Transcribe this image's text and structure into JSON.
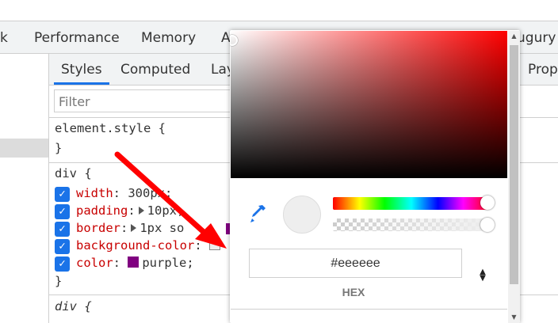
{
  "devtools": {
    "panel_tabs": [
      "k",
      "Performance",
      "Memory",
      "A",
      "ugury"
    ],
    "sub_tabs": [
      "Styles",
      "Computed",
      "Lay",
      "Prop"
    ],
    "filter_placeholder": "Filter"
  },
  "styles": {
    "element_style_selector": "element.style {",
    "close_brace": "}",
    "div_selector": "div {",
    "properties": [
      {
        "name": "width",
        "value": "300px;"
      },
      {
        "name": "padding",
        "value": "10px;"
      },
      {
        "name": "border",
        "value": "1px so"
      },
      {
        "name": "background-color",
        "value": ""
      },
      {
        "name": "color",
        "value": "purple;"
      }
    ],
    "next_selector": "div {"
  },
  "color_picker": {
    "current_color": "#eeeeee",
    "hex_value": "#eeeeee",
    "format_label": "HEX"
  },
  "colors": {
    "accent": "#1a73e8",
    "property_name": "#c80000",
    "purple": "#800080",
    "arrow": "#ff0000"
  }
}
